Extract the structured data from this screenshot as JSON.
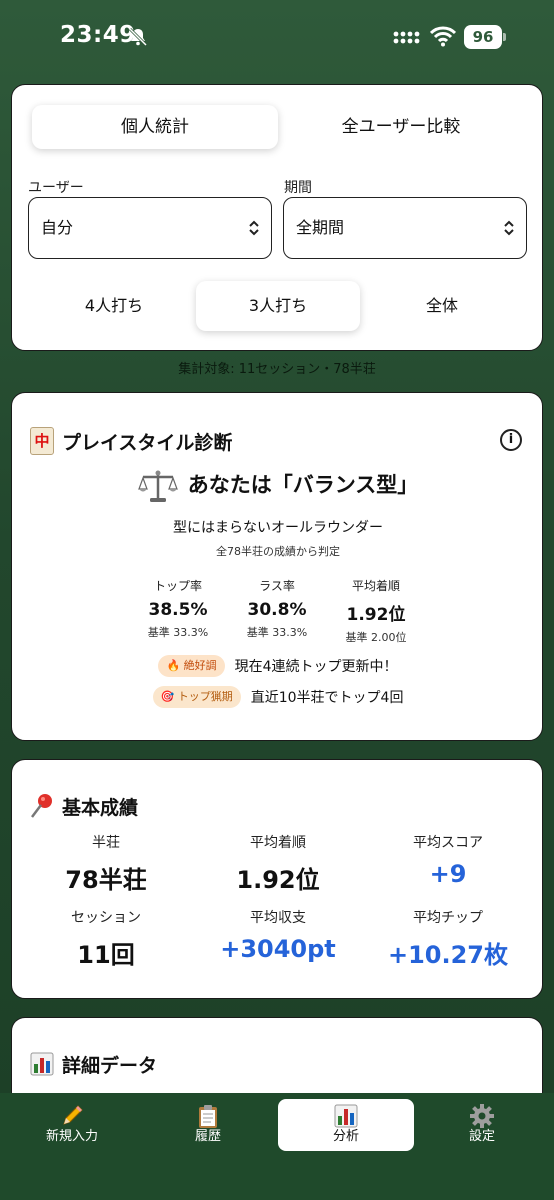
{
  "status_bar": {
    "time": "23:49",
    "battery": "96"
  },
  "filters": {
    "view_tabs": [
      "個人統計",
      "全ユーザー比較"
    ],
    "user_label": "ユーザー",
    "user_value": "自分",
    "period_label": "期間",
    "period_value": "全期間",
    "modes": [
      "4人打ち",
      "3人打ち",
      "全体"
    ],
    "active_mode": "3人打ち"
  },
  "summary": "集計対象: 11セッション・78半荘",
  "playstyle": {
    "title": "プレイスタイル診断",
    "tile_char": "中",
    "result": "あなたは「バランス型」",
    "description": "型にはまらないオールラウンダー",
    "note": "全78半荘の成績から判定",
    "metrics": [
      {
        "label": "トップ率",
        "value": "38.5%",
        "base": "基準 33.3%"
      },
      {
        "label": "ラス率",
        "value": "30.8%",
        "base": "基準 33.3%"
      },
      {
        "label": "平均着順",
        "value": "1.92位",
        "base": "基準 2.00位"
      }
    ],
    "badges": [
      {
        "emoji": "🔥",
        "label": "絶好調",
        "text": "現在4連続トップ更新中！"
      },
      {
        "emoji": "🎯",
        "label": "トップ猟期",
        "text": "直近10半荘でトップ4回"
      }
    ]
  },
  "basic": {
    "title": "基本成績",
    "stats": [
      {
        "label": "半荘",
        "value": "78半荘"
      },
      {
        "label": "平均着順",
        "value": "1.92位"
      },
      {
        "label": "平均スコア",
        "value": "+9"
      },
      {
        "label": "セッション",
        "value": "11回"
      },
      {
        "label": "平均収支",
        "value": "+3040pt"
      },
      {
        "label": "平均チップ",
        "value": "+10.27枚"
      }
    ]
  },
  "detail": {
    "title": "詳細データ"
  },
  "tabbar": {
    "tabs": [
      {
        "label": "新規入力",
        "icon": "pencil-icon"
      },
      {
        "label": "履歴",
        "icon": "clipboard-icon"
      },
      {
        "label": "分析",
        "icon": "bar-chart-icon"
      },
      {
        "label": "設定",
        "icon": "gear-icon"
      }
    ],
    "active": "分析"
  },
  "colors": {
    "background": "#22472d",
    "accent_blue": "#2563d9",
    "badge_orange": "#c24b0a"
  }
}
